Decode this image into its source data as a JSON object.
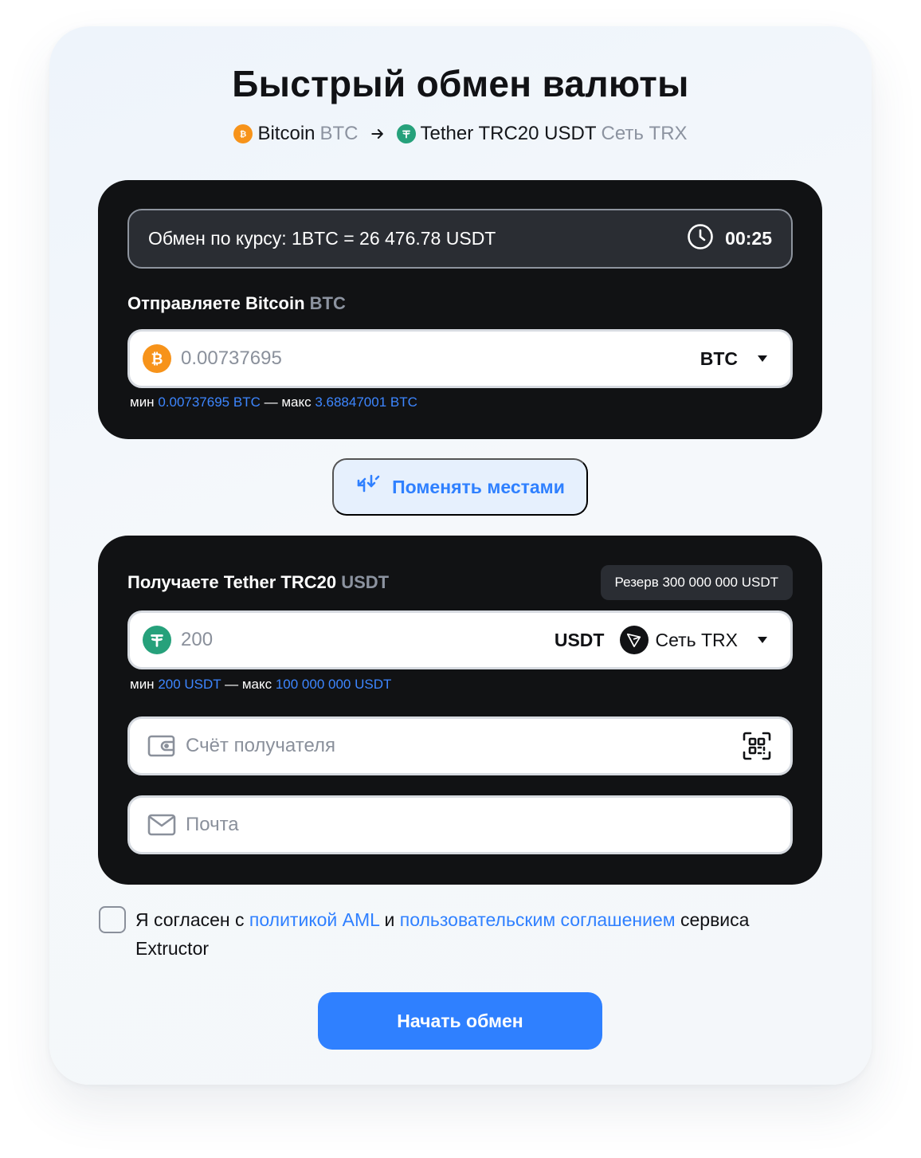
{
  "header": {
    "title": "Быстрый обмен валюты",
    "from_name": "Bitcoin",
    "from_ticker": "BTC",
    "to_name": "Tether TRC20 USDT",
    "to_network": "Сеть TRX"
  },
  "send": {
    "rate_text": "Обмен по курсу: 1BTC = 26 476.78 USDT",
    "timer": "00:25",
    "label": "Отправляете Bitcoin",
    "label_ticker": "BTC",
    "amount_placeholder": "0.00737695",
    "currency": "BTC",
    "min_prefix": "мин",
    "min_value": "0.00737695 BTC",
    "separator": "— макс",
    "max_value": "3.68847001 BTC"
  },
  "swap": {
    "label": "Поменять местами"
  },
  "receive": {
    "label": "Получаете Tether TRC20",
    "label_ticker": "USDT",
    "reserve": "Резерв 300 000 000 USDT",
    "amount_placeholder": "200",
    "currency": "USDT",
    "network": "Сеть TRX",
    "min_prefix": "мин",
    "min_value": "200 USDT",
    "separator": "— макс",
    "max_value": "100 000 000 USDT",
    "account_placeholder": "Счёт получателя",
    "email_placeholder": "Почта"
  },
  "agreement": {
    "text1": "Я согласен с",
    "link1": "политикой AML",
    "text2": "и",
    "link2": "пользовательским соглашением",
    "text3": "сервиса",
    "text4": "Extructor"
  },
  "submit": {
    "label": "Начать обмен"
  },
  "colors": {
    "accent": "#2f80ff",
    "panel": "#111214",
    "bitcoin": "#f7931a",
    "tether": "#26a17b"
  },
  "icons": [
    "bitcoin-icon",
    "tether-icon",
    "arrow-right-icon",
    "clock-icon",
    "chevron-down-icon",
    "swap-arrows-icon",
    "tron-icon",
    "wallet-icon",
    "qr-scan-icon",
    "mail-icon"
  ]
}
